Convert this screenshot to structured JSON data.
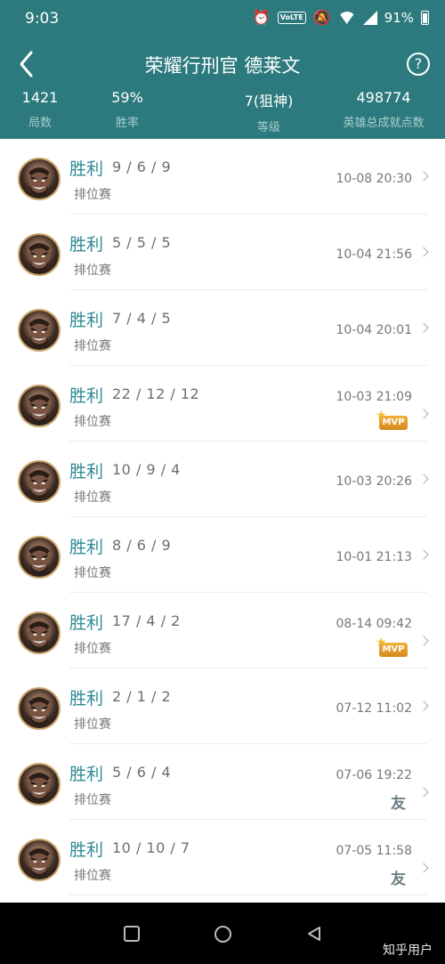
{
  "status_bar": {
    "time": "9:03",
    "volte": "VoLTE",
    "battery": "91%",
    "icons": [
      "alarm-icon",
      "volte-icon",
      "mute-icon",
      "wifi-icon",
      "signal-icon",
      "battery-icon"
    ]
  },
  "header": {
    "title": "荣耀行刑官 德莱文",
    "help": "?",
    "accent_color": "#2c7a7d"
  },
  "stats": [
    {
      "value": "1421",
      "label": "局数"
    },
    {
      "value": "59%",
      "label": "胜率"
    },
    {
      "value": "7(狙神)",
      "label": "等级"
    },
    {
      "value": "498774",
      "label": "英雄总成就点数"
    }
  ],
  "matches": [
    {
      "result": "胜利",
      "kda": "9 / 6 / 9",
      "mode": "排位赛",
      "time": "10-08 20:30",
      "badge": ""
    },
    {
      "result": "胜利",
      "kda": "5 / 5 / 5",
      "mode": "排位赛",
      "time": "10-04 21:56",
      "badge": ""
    },
    {
      "result": "胜利",
      "kda": "7 / 4 / 5",
      "mode": "排位赛",
      "time": "10-04 20:01",
      "badge": ""
    },
    {
      "result": "胜利",
      "kda": "22 / 12 / 12",
      "mode": "排位赛",
      "time": "10-03 21:09",
      "badge": "MVP"
    },
    {
      "result": "胜利",
      "kda": "10 / 9 / 4",
      "mode": "排位赛",
      "time": "10-03 20:26",
      "badge": ""
    },
    {
      "result": "胜利",
      "kda": "8 / 6 / 9",
      "mode": "排位赛",
      "time": "10-01 21:13",
      "badge": ""
    },
    {
      "result": "胜利",
      "kda": "17 / 4 / 2",
      "mode": "排位赛",
      "time": "08-14 09:42",
      "badge": "MVP"
    },
    {
      "result": "胜利",
      "kda": "2 / 1 / 2",
      "mode": "排位赛",
      "time": "07-12 11:02",
      "badge": ""
    },
    {
      "result": "胜利",
      "kda": "5 / 6 / 4",
      "mode": "排位赛",
      "time": "07-06 19:22",
      "badge": "友"
    },
    {
      "result": "胜利",
      "kda": "10 / 10 / 7",
      "mode": "排位赛",
      "time": "07-05 11:58",
      "badge": "友"
    }
  ],
  "watermark": "知乎用户"
}
